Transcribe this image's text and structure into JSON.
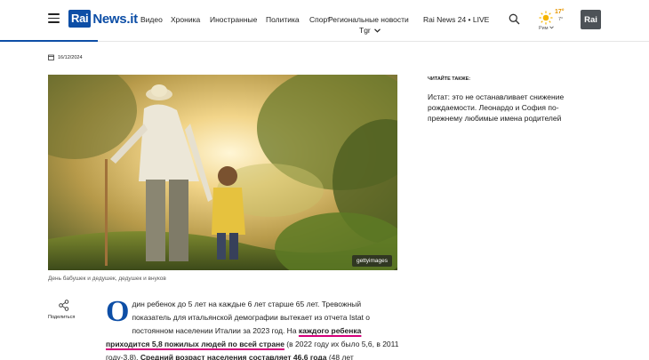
{
  "header": {
    "logo_rai": "Rai",
    "logo_news": "News.it",
    "nav": [
      "Видео",
      "Хроника",
      "Иностранные",
      "Политика",
      "Спорт",
      "Региональные новости"
    ],
    "tgr": "Tgr",
    "live": "Rai News 24 • LIVE",
    "weather": {
      "temp_hi": "17°",
      "temp_lo": "7°",
      "city": "Рим"
    },
    "badge": "Rai",
    "brand_color": "#0d4ea6",
    "accent_color": "#d4007a"
  },
  "article": {
    "date": "16/12/2024",
    "image_credit": "gettyimages",
    "caption": "День бабушек и дедушек, дедушек и внуков",
    "share_label": "Поделиться",
    "dropcap": "О",
    "p1": "дин ребенок до 5 лет на каждые 6 лет старше 65 лет. Тревожный показатель для итальянской демографии вытекает из отчета Istat о постоянном населении Италии за 2023 год. На ",
    "p2": "каждого ребенка приходится 5,8 пожилых людей по всей стране",
    "p3": " (в 2022 году их было 5,6, в 2011 году-3,8). ",
    "p4": "Средний возраст населения составляет 46,6 года",
    "p5": " (48 лет"
  },
  "sidebar": {
    "read_also": "ЧИТАЙТЕ ТАКЖЕ:",
    "related": "Истат: это не останавливает снижение рождаемости. Леонардо и София по-прежнему любимые имена родителей"
  }
}
